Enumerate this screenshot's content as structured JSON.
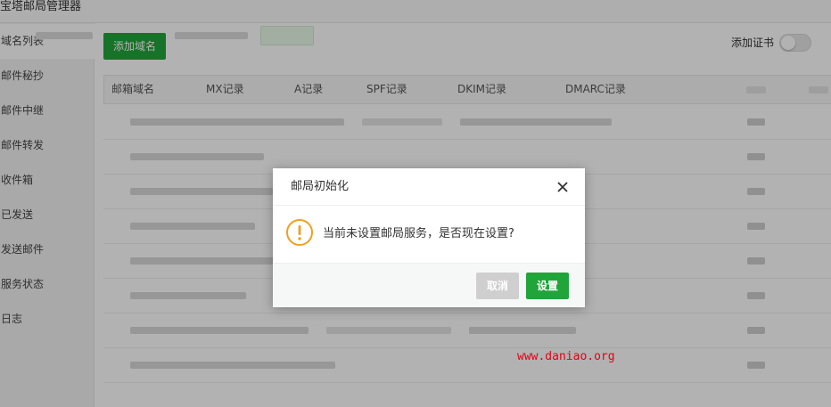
{
  "app": {
    "title": "宝塔邮局管理器"
  },
  "sidebar": {
    "items": [
      {
        "label": "域名列表",
        "active": true
      },
      {
        "label": "邮件秘抄"
      },
      {
        "label": "邮件中继"
      },
      {
        "label": "邮件转发"
      },
      {
        "label": "收件箱"
      },
      {
        "label": "已发送"
      },
      {
        "label": "发送邮件"
      },
      {
        "label": "服务状态"
      },
      {
        "label": "日志"
      }
    ]
  },
  "toolbar": {
    "add_domain": "添加域名",
    "add_cert": "添加证书",
    "add_cert_enabled": false
  },
  "table": {
    "columns": [
      "邮箱域名",
      "MX记录",
      "A记录",
      "SPF记录",
      "DKIM记录",
      "DMARC记录"
    ]
  },
  "dialog": {
    "title": "邮局初始化",
    "message": "当前未设置邮局服务，是否现在设置?",
    "cancel": "取消",
    "confirm": "设置"
  },
  "watermark": "www.daniao.org",
  "colors": {
    "primary": "#20a53a",
    "warning": "#f0a020",
    "watermark": "#e60012"
  }
}
